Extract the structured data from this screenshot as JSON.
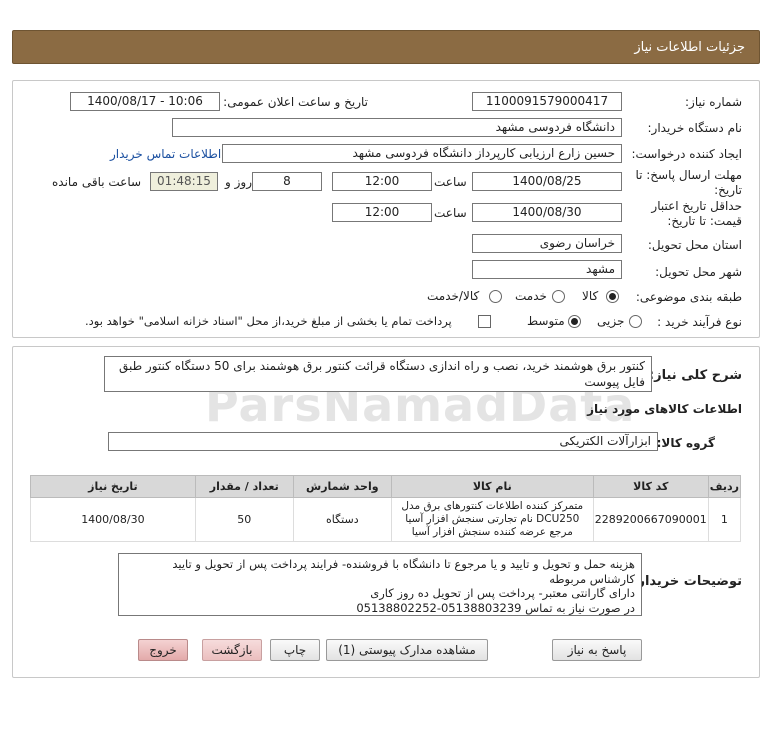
{
  "header": {
    "title": "جزئیات اطلاعات نیاز"
  },
  "form": {
    "need_number_label": "شماره نیاز:",
    "need_number": "1100091579000417",
    "announce_label": "تاریخ و ساعت اعلان عمومی:",
    "announce_value": "1400/08/17 - 10:06",
    "buyer_org_label": "نام دستگاه خریدار:",
    "buyer_org": "دانشگاه فردوسی مشهد",
    "requester_label": "ایجاد کننده درخواست:",
    "requester": "حسین زارع ارزیابی کارپرداز دانشگاه فردوسی مشهد",
    "contact_link": "اطلاعات تماس خریدار",
    "deadline_label": "مهلت ارسال پاسخ: تا تاریخ:",
    "deadline_date": "1400/08/25",
    "time_label": "ساعت",
    "deadline_time": "12:00",
    "days_value": "8",
    "days_label": "روز و",
    "remaining_time": "01:48:15",
    "remaining_label": "ساعت باقی مانده",
    "validity_label": "حداقل تاریخ اعتبار قیمت: تا تاریخ:",
    "validity_date": "1400/08/30",
    "validity_time": "12:00",
    "province_label": "استان محل تحویل:",
    "province": "خراسان رضوی",
    "city_label": "شهر محل تحویل:",
    "city": "مشهد",
    "category_label": "طبقه بندی موضوعی:",
    "category_options": [
      "کالا",
      "خدمت",
      "کالا/خدمت"
    ],
    "process_label": "نوع فرآیند خرید :",
    "process_options": [
      "جزیی",
      "متوسط"
    ],
    "payment_text": "پرداخت تمام یا بخشی از مبلغ خرید،از محل \"اسناد خزانه اسلامی\" خواهد بود."
  },
  "summary": {
    "label": "شرح کلی نیاز:",
    "text": "کنتور برق هوشمند خرید، نصب و راه اندازی دستگاه قرائت کنتور برق هوشمند برای 50 دستگاه کنتور  طبق فایل پیوست"
  },
  "goods": {
    "section_title": "اطلاعات کالاهای مورد نیاز",
    "group_label": "گروه کالا:",
    "group_value": "ابزارآلات الکتریکی",
    "columns": [
      "ردیف",
      "کد کالا",
      "نام کالا",
      "واحد شمارش",
      "تعداد / مقدار",
      "تاریخ نیاز"
    ],
    "rows": [
      {
        "row": "1",
        "code": "2289200667090001",
        "name": "متمرکز کننده اطلاعات کنتورهای برق مدل DCU250 نام تجارتی سنجش افزار آسیا مرجع عرضه کننده سنجش افزار آسیا",
        "unit": "دستگاه",
        "qty": "50",
        "date": "1400/08/30"
      }
    ]
  },
  "notes": {
    "label": "توضیحات خریدار:",
    "lines": [
      "هزینه حمل و تحویل و تایید و یا مرجوع تا دانشگاه با فروشنده- فرایند پرداخت پس از تحویل و تایید کارشناس مربوطه",
      "دارای گارانتی معتبر- پرداخت پس از تحویل ده روز کاری",
      "در صورت نیاز به تماس 05138803239-05138802252"
    ]
  },
  "buttons": {
    "reply": "پاسخ به نیاز",
    "attachments": "مشاهده مدارک پیوستی (1)",
    "print": "چاپ",
    "back": "بازگشت",
    "exit": "خروج"
  },
  "watermark": {
    "brand": "ParsNamadData"
  }
}
